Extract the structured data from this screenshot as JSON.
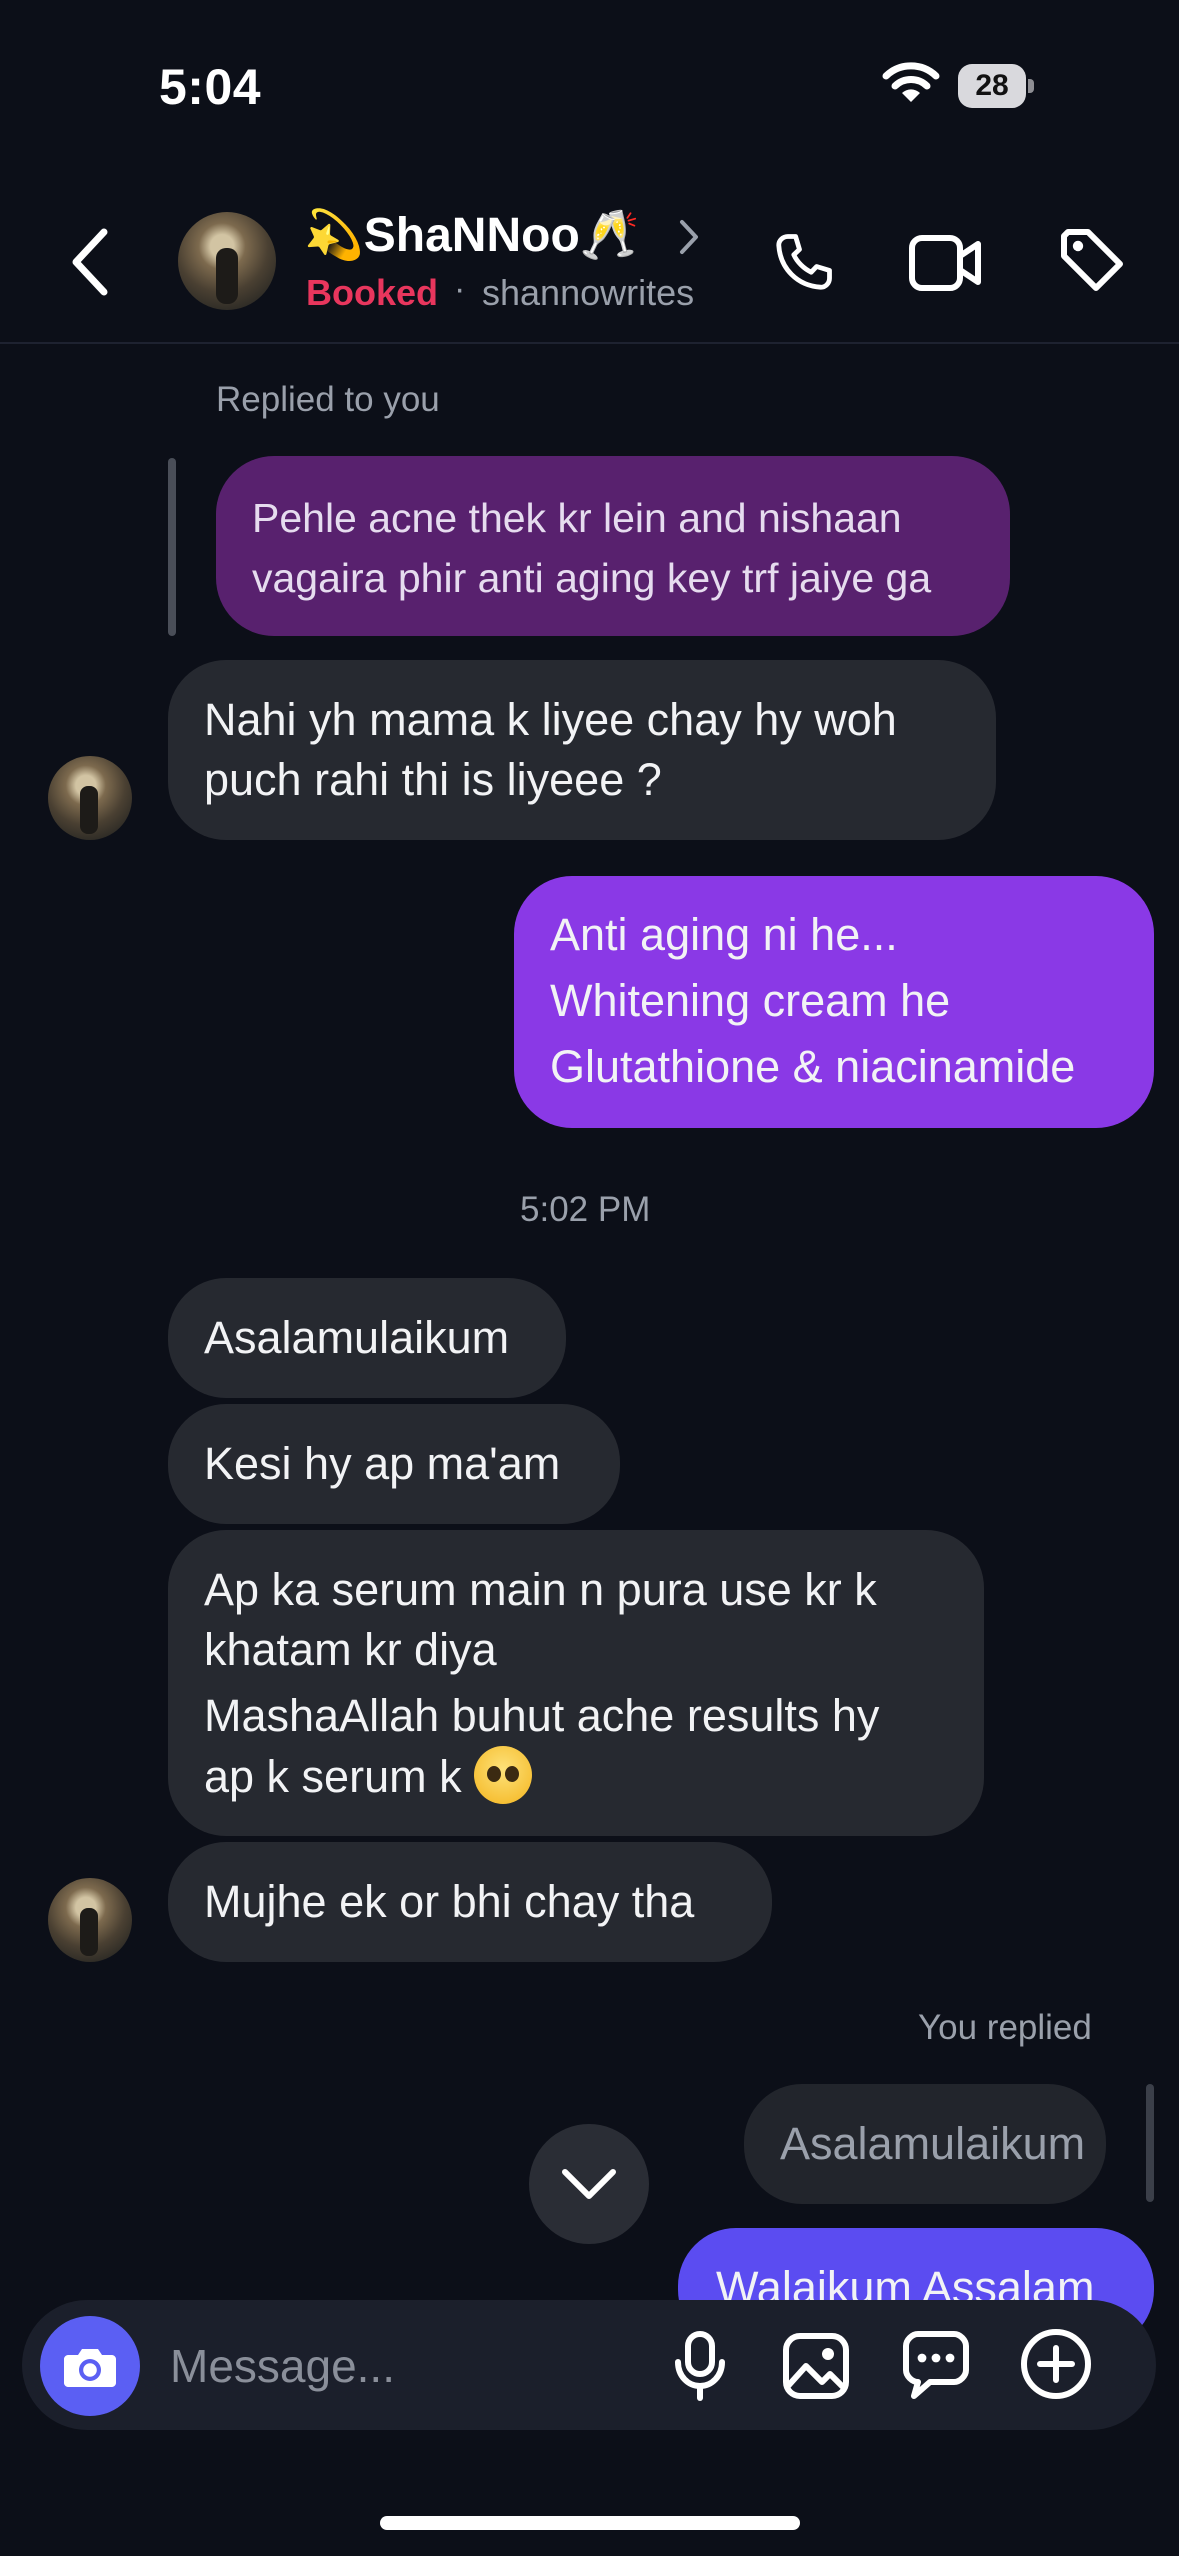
{
  "status_bar": {
    "time": "5:04",
    "battery_level": "28",
    "wifi_icon": "wifi-icon"
  },
  "header": {
    "contact_name": "💫ShaNNoo🥂",
    "status_label": "Booked",
    "separator": "·",
    "handle": "shannowrites",
    "icons": [
      "back-icon",
      "chevron-right-icon",
      "phone-icon",
      "video-icon",
      "tag-icon"
    ]
  },
  "messages": {
    "replied_label": "Replied to you",
    "quoted_message": [
      "Pehle acne thek kr lein and nishaan",
      "vagaira phir anti aging key trf jaiye ga"
    ],
    "msg1": [
      "Nahi yh mama k liyee chay hy woh",
      "puch rahi thi is liyeee ?"
    ],
    "msg2": [
      "Anti aging ni he...",
      "Whitening cream he",
      "Glutathione & niacinamide"
    ],
    "timestamp": "5:02 PM",
    "msg3": "Asalamulaikum",
    "msg4": "Kesi hy ap ma'am",
    "msg5": [
      "Ap ka serum main n pura use kr k",
      "khatam kr diya",
      "MashaAllah buhut ache results hy",
      "ap k serum k"
    ],
    "msg5_emoji": "pleading-face",
    "msg6": "Mujhe ek or bhi chay tha",
    "you_replied_label": "You replied",
    "you_replied_quote": "Asalamulaikum",
    "msg7": "Walaikum Assalam"
  },
  "composer": {
    "placeholder": "Message...",
    "icons": [
      "camera-icon",
      "microphone-icon",
      "gallery-icon",
      "sticker-icon",
      "plus-icon"
    ]
  },
  "colors": {
    "background": "#0c0f18",
    "incoming_bubble": "#262930",
    "outgoing_bubble": "#8a39e6",
    "outgoing_quote": "#58216e",
    "status_booked": "#e8365d",
    "camera_button": "#5b5ff3"
  }
}
